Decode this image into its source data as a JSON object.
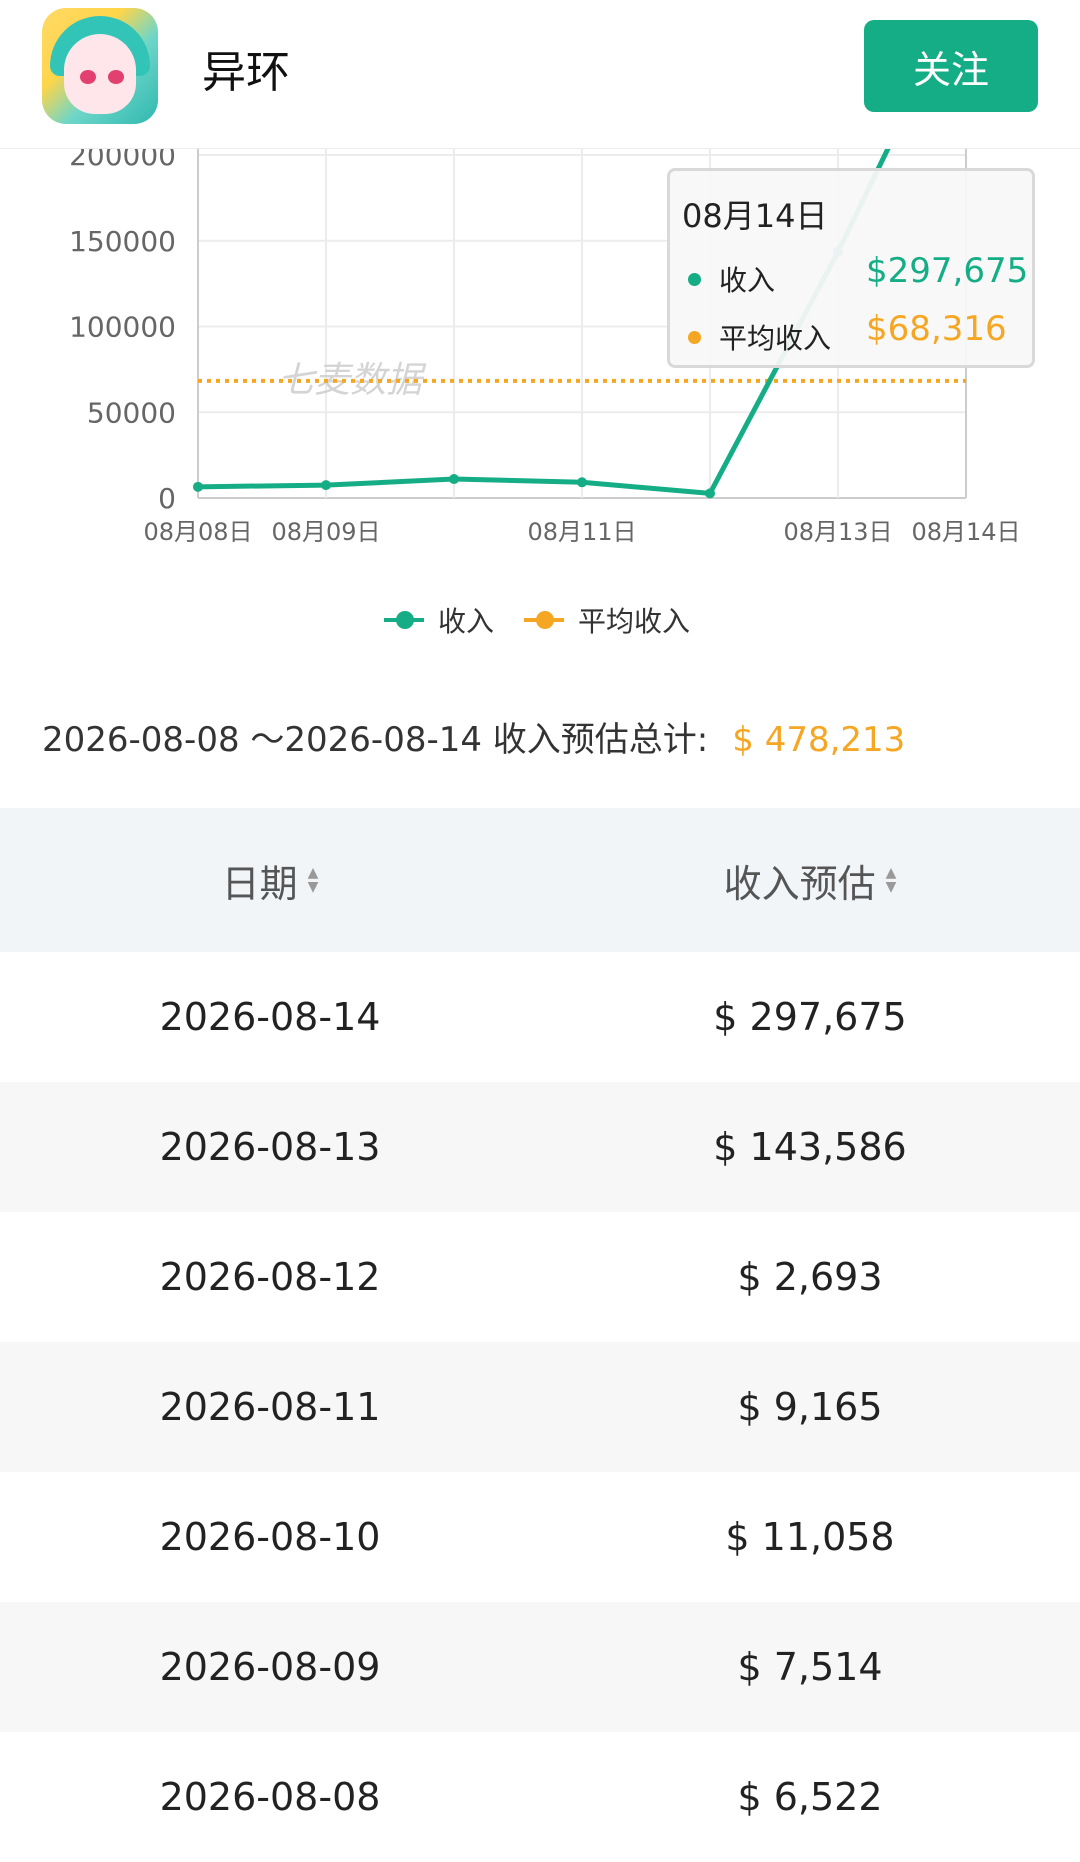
{
  "header": {
    "app_name": "异环",
    "follow_label": "关注",
    "icon": "app-icon-anime-character"
  },
  "chart_data": {
    "type": "line",
    "title": "",
    "xlabel": "",
    "ylabel": "",
    "x_tick_labels": [
      "08月08日",
      "08月09日",
      "08月11日",
      "08月13日",
      "08月14日"
    ],
    "y_tick_labels": [
      "0",
      "50000",
      "100000",
      "150000",
      "200000"
    ],
    "ylim": [
      0,
      200000
    ],
    "grid": true,
    "legend_position": "bottom",
    "watermark": "七麦数据",
    "categories": [
      "08月08日",
      "08月09日",
      "08月10日",
      "08月11日",
      "08月12日",
      "08月13日",
      "08月14日"
    ],
    "series": [
      {
        "name": "收入",
        "color": "#15ad85",
        "values": [
          6522,
          7514,
          11058,
          9165,
          2693,
          143586,
          297675
        ]
      },
      {
        "name": "平均收入",
        "color": "#f5a623",
        "values": [
          68316,
          68316,
          68316,
          68316,
          68316,
          68316,
          68316
        ]
      }
    ],
    "tooltip": {
      "date": "08月14日",
      "rows": [
        {
          "label": "收入",
          "value": "$297,675",
          "color": "#15ad85"
        },
        {
          "label": "平均收入",
          "value": "$68,316",
          "color": "#f5a623"
        }
      ]
    }
  },
  "legend": [
    {
      "label": "收入",
      "color": "#15ad85"
    },
    {
      "label": "平均收入",
      "color": "#f5a623"
    }
  ],
  "summary": {
    "range_text": "2026-08-08 ～2026-08-14 收入预估总计:",
    "total": "$ 478,213"
  },
  "table": {
    "headers": [
      "日期",
      "收入预估"
    ],
    "rows": [
      {
        "date": "2026-08-14",
        "revenue": "$ 297,675"
      },
      {
        "date": "2026-08-13",
        "revenue": "$ 143,586"
      },
      {
        "date": "2026-08-12",
        "revenue": "$ 2,693"
      },
      {
        "date": "2026-08-11",
        "revenue": "$ 9,165"
      },
      {
        "date": "2026-08-10",
        "revenue": "$ 11,058"
      },
      {
        "date": "2026-08-09",
        "revenue": "$ 7,514"
      },
      {
        "date": "2026-08-08",
        "revenue": "$ 6,522"
      }
    ]
  }
}
